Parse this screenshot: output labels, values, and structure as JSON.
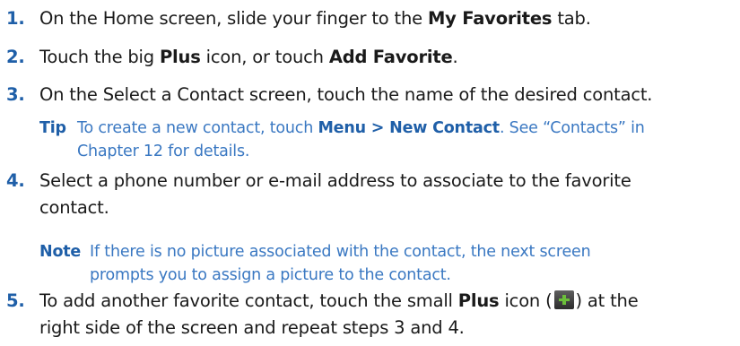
{
  "steps": [
    {
      "num": "1.",
      "t1": "On the Home screen, slide your finger to the ",
      "b1": "My Favorites",
      "t2": " tab."
    },
    {
      "num": "2.",
      "t1": "Touch the big ",
      "b1": "Plus",
      "t2": " icon, or touch ",
      "b2": "Add Favorite",
      "t3": "."
    },
    {
      "num": "3.",
      "t1": "On the Select a Contact screen, touch the name of the desired contact."
    },
    {
      "num": "4.",
      "t1": "Select a phone number or e-mail address to associate to the favorite",
      "t2": "contact."
    },
    {
      "num": "5.",
      "t1": "To add another favorite contact, touch the small ",
      "b1": "Plus",
      "t2": " icon (",
      "t3": ") at the",
      "t4": "right side of the screen and repeat steps 3 and 4."
    }
  ],
  "tip": {
    "label": "Tip",
    "t1": "To create a new contact, touch ",
    "b1": "Menu > New Contact",
    "t2": ". See “Contacts” in",
    "t3": "Chapter 12 for details."
  },
  "note": {
    "label": "Note",
    "t1": "If there is no picture associated with the contact, the next screen",
    "t2": "prompts you to assign a picture to the contact."
  },
  "icons": {
    "inline_plus": "plus-icon"
  },
  "colors": {
    "number": "#1f5fa8",
    "callout": "#3a78c2",
    "plus_green": "#6bbf3a"
  }
}
